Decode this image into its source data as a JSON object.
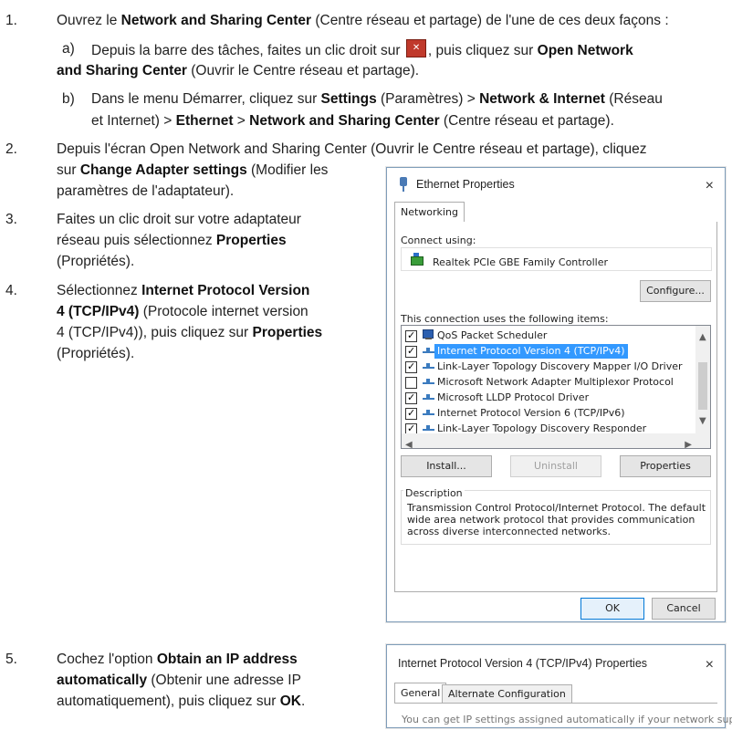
{
  "steps": {
    "s1": {
      "num": "1.",
      "pre": "Ouvrez le ",
      "bold": "Network and Sharing Center",
      "post": " (Centre réseau et partage) de l'une de ces deux façons :",
      "a": {
        "letter": "a)",
        "pre": "Depuis la barre des tâches, faites un clic droit sur ",
        "mid": ", puis cliquez sur ",
        "bold1": "Open Network",
        "bold2": "and Sharing Center",
        "post": " (Ouvrir le Centre réseau et partage)."
      },
      "b": {
        "letter": "b)",
        "pre": "Dans le menu Démarrer, cliquez sur ",
        "bold1": "Settings",
        "mid1": " (Paramètres) > ",
        "bold2": "Network & Internet",
        "mid2": " (Réseau",
        "line2pre": "et Internet) > ",
        "bold3": "Ethernet",
        "mid3": " > ",
        "bold4": "Network and Sharing Center",
        "post": " (Centre réseau et partage)."
      }
    },
    "s2": {
      "num": "2.",
      "line1": "Depuis l'écran Open Network and Sharing Center (Ouvrir le Centre réseau et partage), cliquez",
      "line2pre": "sur ",
      "bold": "Change Adapter settings",
      "line2post": " (Modifier les",
      "line3": "paramètres de l'adaptateur)."
    },
    "s3": {
      "num": "3.",
      "line1": "Faites un clic droit sur votre adaptateur",
      "line2": "réseau puis sélectionnez ",
      "bold": "Properties",
      "line3": "(Propriétés)."
    },
    "s4": {
      "num": "4.",
      "pre": "Sélectionnez ",
      "bold1": "Internet Protocol Version",
      "bold2": "4 (TCP/IPv4)",
      "mid": " (Protocole internet version",
      "line3pre": "4 (TCP/IPv4)), puis cliquez sur ",
      "bold3": "Properties",
      "line4": "(Propriétés)."
    },
    "s5": {
      "num": "5.",
      "pre": "Cochez l'option ",
      "bold1": "Obtain an IP address",
      "bold2": "automatically",
      "mid": " (Obtenir une adresse IP",
      "line3pre": "automatiquement), puis cliquez sur ",
      "bold3": "OK",
      "line3post": "."
    }
  },
  "eth_dialog": {
    "title": "Ethernet Properties",
    "close": "×",
    "tab": "Networking",
    "connect_using": "Connect using:",
    "adapter": "Realtek PCIe GBE Family Controller",
    "configure": "Configure...",
    "items_label": "This connection uses the following items:",
    "items": [
      {
        "label": "QoS Packet Scheduler",
        "checked": true,
        "icon": "qos",
        "selected": false
      },
      {
        "label": "Internet Protocol Version 4 (TCP/IPv4)",
        "checked": true,
        "icon": "net",
        "selected": true
      },
      {
        "label": "Link-Layer Topology Discovery Mapper I/O Driver",
        "checked": true,
        "icon": "net",
        "selected": false
      },
      {
        "label": "Microsoft Network Adapter Multiplexor Protocol",
        "checked": false,
        "icon": "net",
        "selected": false
      },
      {
        "label": "Microsoft LLDP Protocol Driver",
        "checked": true,
        "icon": "net",
        "selected": false
      },
      {
        "label": "Internet Protocol Version 6 (TCP/IPv6)",
        "checked": true,
        "icon": "net",
        "selected": false
      },
      {
        "label": "Link-Layer Topology Discovery Responder",
        "checked": true,
        "icon": "net",
        "selected": false
      }
    ],
    "install": "Install...",
    "uninstall": "Uninstall",
    "properties": "Properties",
    "description_label": "Description",
    "description": [
      "Transmission Control Protocol/Internet Protocol. The default",
      "wide area network protocol that provides communication",
      "across diverse interconnected networks."
    ],
    "ok": "OK",
    "cancel": "Cancel"
  },
  "ipv4_dialog": {
    "title": "Internet Protocol Version 4 (TCP/IPv4) Properties",
    "close": "×",
    "tab_general": "General",
    "tab_alternate": "Alternate Configuration",
    "partial_text": "You can get IP settings assigned automatically if your network supports"
  }
}
